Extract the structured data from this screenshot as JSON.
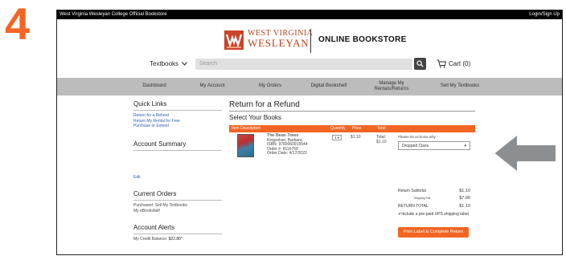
{
  "step_number": "4",
  "topbar": {
    "site_name": "West Virginia Wesleyan College Official Bookstore",
    "login": "Login/Sign Up"
  },
  "logo": {
    "line1": "WEST VIRGINIA",
    "line2": "WESLEYAN",
    "online_bookstore": "ONLINE BOOKSTORE"
  },
  "search": {
    "category": "Textbooks",
    "placeholder": "Search",
    "cart_label": "Cart (0)"
  },
  "nav": {
    "items": [
      "Dashboard",
      "My Account",
      "My Orders",
      "Digital Bookshelf",
      "Manage My Rentals/Returns",
      "Sell My Textbooks"
    ]
  },
  "sidebar": {
    "quick_links_title": "Quick Links",
    "quick_links": [
      "Return for a Refund",
      "Return My Rental for Free",
      "Purchase or Extend"
    ],
    "account_summary_title": "Account Summary",
    "edit_label": "Edit",
    "current_orders_title": "Current Orders",
    "current_orders": [
      "Purchased: Sell My Textbooks",
      "My eBookshelf"
    ],
    "account_alerts_title": "Account Alerts",
    "credit_label": "My Credit Balance:",
    "credit_value": "$22.80*"
  },
  "main": {
    "title": "Return for a Refund",
    "subtitle": "Select Your Books",
    "table_headers": {
      "item": "Item Description",
      "quantity": "Quantity",
      "price": "Price",
      "total": "Total"
    },
    "book": {
      "title": "The Bean Trees",
      "author": "Kingsolver, Barbara",
      "isbn": "ISBN: 9780060915544",
      "order": "Order #: 8116758",
      "order_date": "Order Date: 4/17/2022",
      "quantity": "1",
      "price": "$1.10",
      "total_label": "Total:",
      "total_value": "$1.10"
    },
    "reason": {
      "label": "Please let us know why:",
      "selected": "Dropped Class"
    },
    "summary": {
      "subtotal_label": "Return Subtotal",
      "subtotal_value": "$1.10",
      "shipping_label": "Shipping Fee",
      "shipping_value": "$7.00",
      "return_total_label": "RETURN TOTAL",
      "return_total_value": "$1.10",
      "ups_text": "Include a pre-paid UPS shipping label.",
      "print_button": "Print Label & Complete Return"
    }
  },
  "colors": {
    "accent": "#f26522",
    "brand_red": "#b9401b",
    "nav_bg": "#bcbcbc",
    "arrow": "#8c8f92"
  }
}
